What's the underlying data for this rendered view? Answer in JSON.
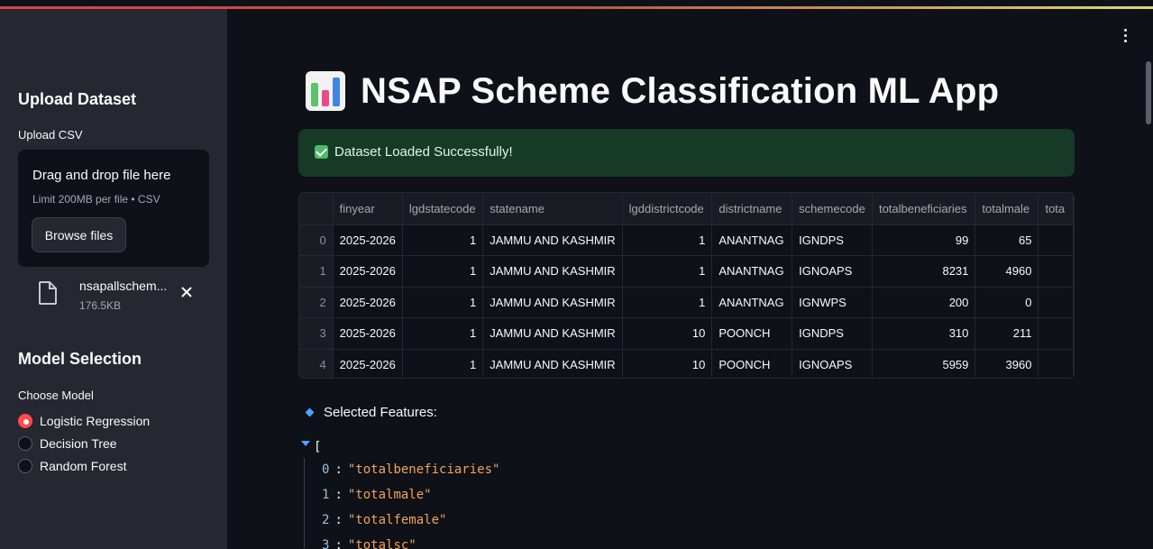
{
  "sidebar": {
    "upload_heading": "Upload Dataset",
    "upload_label": "Upload CSV",
    "dropzone_text": "Drag and drop file here",
    "dropzone_limit": "Limit 200MB per file • CSV",
    "browse_label": "Browse files",
    "file": {
      "name": "nsapallschem...",
      "size": "176.5KB"
    },
    "model_heading": "Model Selection",
    "model_label": "Choose Model",
    "models": [
      "Logistic Regression",
      "Decision Tree",
      "Random Forest"
    ],
    "selected_model": "Logistic Regression"
  },
  "main": {
    "title": "NSAP Scheme Classification ML App",
    "success_message": "Dataset Loaded Successfully!",
    "table": {
      "columns": [
        "",
        "finyear",
        "lgdstatecode",
        "statename",
        "lgddistrictcode",
        "districtname",
        "schemecode",
        "totalbeneficiaries",
        "totalmale",
        "tota"
      ],
      "rows": [
        [
          "0",
          "2025-2026",
          "1",
          "JAMMU AND KASHMIR",
          "1",
          "ANANTNAG",
          "IGNDPS",
          "99",
          "65",
          ""
        ],
        [
          "1",
          "2025-2026",
          "1",
          "JAMMU AND KASHMIR",
          "1",
          "ANANTNAG",
          "IGNOAPS",
          "8231",
          "4960",
          ""
        ],
        [
          "2",
          "2025-2026",
          "1",
          "JAMMU AND KASHMIR",
          "1",
          "ANANTNAG",
          "IGNWPS",
          "200",
          "0",
          ""
        ],
        [
          "3",
          "2025-2026",
          "1",
          "JAMMU AND KASHMIR",
          "10",
          "POONCH",
          "IGNDPS",
          "310",
          "211",
          ""
        ],
        [
          "4",
          "2025-2026",
          "1",
          "JAMMU AND KASHMIR",
          "10",
          "POONCH",
          "IGNOAPS",
          "5959",
          "3960",
          ""
        ]
      ]
    },
    "features_label": "Selected Features:",
    "json_open": "[",
    "features": [
      {
        "index": "0",
        "value": "\"totalbeneficiaries\""
      },
      {
        "index": "1",
        "value": "\"totalmale\""
      },
      {
        "index": "2",
        "value": "\"totalfemale\""
      },
      {
        "index": "3",
        "value": "\"totalsc\""
      }
    ]
  },
  "icons": {
    "menu": "kebab-menu-icon",
    "file": "file-icon",
    "close": "close-icon",
    "title": "bar-chart-icon",
    "success": "check-icon"
  },
  "colors": {
    "accent": "#ff4b4b",
    "success_bg": "#173928",
    "json_value": "#f0a35e",
    "json_key": "#98c1e2"
  }
}
